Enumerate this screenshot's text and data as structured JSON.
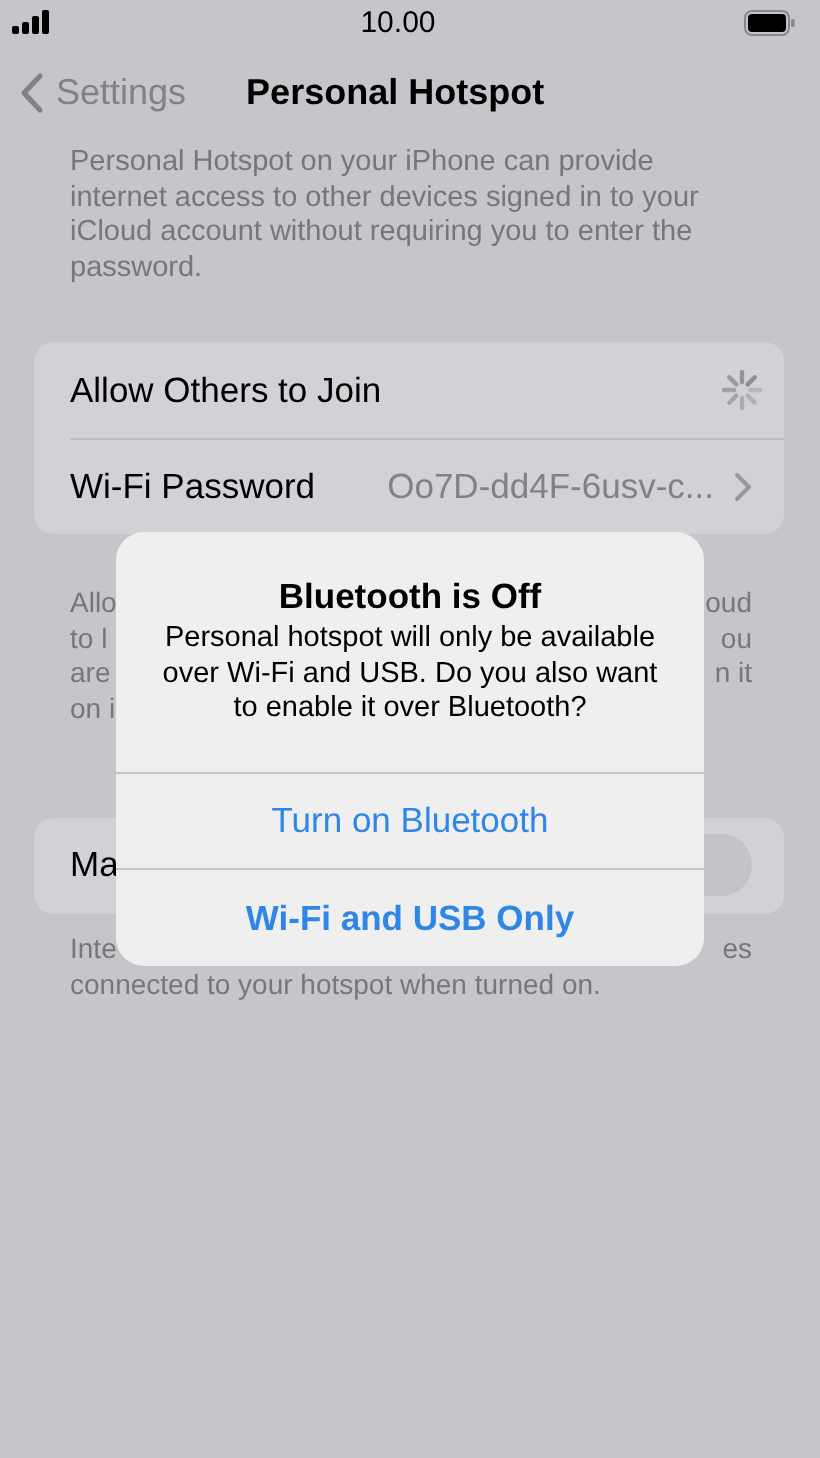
{
  "status_bar": {
    "time": "10.00"
  },
  "nav": {
    "back": "Settings",
    "title": "Personal Hotspot"
  },
  "description": "Personal Hotspot on your iPhone can provide internet access to other devices signed in to your iCloud account without requiring you to enter the password.",
  "settings_group": {
    "rows": [
      {
        "kind": "spinner",
        "label": "Allow Others to Join"
      },
      {
        "kind": "link",
        "label": "Wi-Fi Password",
        "value": "Oo7D-dd4F-6usv-c..."
      }
    ]
  },
  "group_footer": {
    "lines": [
      {
        "start": "Allo",
        "end": "oud"
      },
      {
        "start": "to l",
        "end": "ou"
      },
      {
        "start": "are",
        "end": "n it"
      },
      {
        "start": "on i"
      }
    ]
  },
  "toggle_group": {
    "label": "Ma",
    "on": false
  },
  "toggle_footer": {
    "line_1_start": "Inte",
    "line_1_end": "es",
    "line_2": "connected to your hotspot when turned on."
  },
  "alert": {
    "title": "Bluetooth is Off",
    "message": "Personal hotspot will only be available over Wi-Fi and USB. Do you also want to enable it over Bluetooth?",
    "buttons": [
      {
        "label": "Turn on Bluetooth",
        "kind": "default"
      },
      {
        "label": "Wi-Fi and USB Only",
        "kind": "preferred"
      }
    ]
  }
}
